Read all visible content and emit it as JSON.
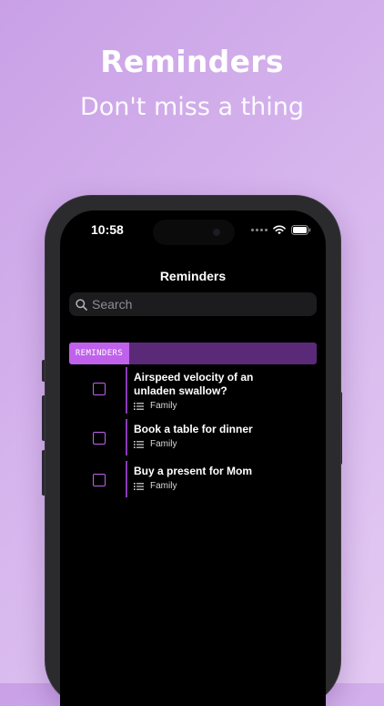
{
  "hero": {
    "title": "Reminders",
    "subtitle": "Don't miss a thing"
  },
  "status_bar": {
    "time": "10:58",
    "icons": [
      "signal-dots-icon",
      "wifi-icon",
      "battery-icon"
    ]
  },
  "nav": {
    "title": "Reminders"
  },
  "search": {
    "placeholder": "Search",
    "icon": "search-icon"
  },
  "section": {
    "label": "REMINDERS"
  },
  "reminders": [
    {
      "title": "Airspeed velocity of an unladen swallow?",
      "list": "Family",
      "completed": false
    },
    {
      "title": "Book a table for dinner",
      "list": "Family",
      "completed": false
    },
    {
      "title": "Buy a present for Mom",
      "list": "Family",
      "completed": false
    }
  ],
  "colors": {
    "accent": "#c061ec",
    "section_bar": "#5a2a78",
    "background_gradient": [
      "#c9a0e6",
      "#e3c9f2"
    ],
    "screen": "#000000"
  }
}
